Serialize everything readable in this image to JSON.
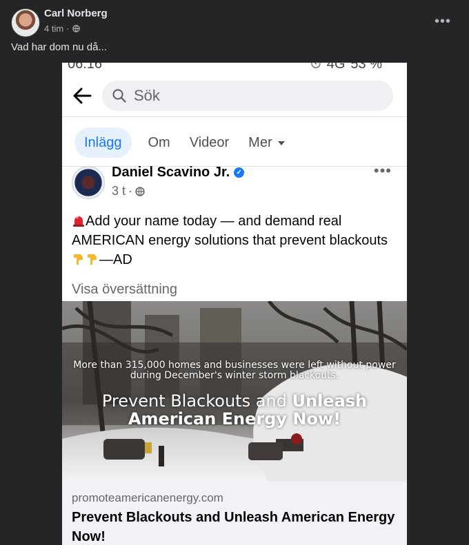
{
  "post": {
    "author": "Carl Norberg",
    "time": "4 tim",
    "separator": "·",
    "text": "Vad har dom nu då..."
  },
  "screenshot": {
    "status_bar": {
      "time": "06:16",
      "network": "4G",
      "battery": "53 %"
    },
    "search": {
      "placeholder": "Sök"
    },
    "tabs": [
      {
        "label": "Inlägg",
        "active": true
      },
      {
        "label": "Om",
        "active": false
      },
      {
        "label": "Videor",
        "active": false
      },
      {
        "label": "Mer",
        "active": false
      }
    ],
    "page_post": {
      "page_name": "Daniel Scavino Jr.",
      "time": "3 t",
      "separator": "·",
      "text_part1": "Add your name today — and demand real AMERICAN energy solutions that prevent blackouts",
      "text_part2": "—AD",
      "translate_link": "Visa översättning"
    },
    "ad": {
      "subtitle": "More than 315,000 homes and businesses were left without power during December's winter storm blackouts.",
      "headline_part1": "Prevent Blackouts and ",
      "headline_part2": "Unleash American Energy Now!",
      "domain": "promoteamericanenergy.com",
      "title": "Prevent Blackouts and Unleash American Energy Now!"
    }
  },
  "colors": {
    "facebook_dark_bg": "#242526",
    "facebook_blue": "#1877f2",
    "active_tab_bg": "#e7f0fd",
    "link_preview_bg": "#f0f2f5"
  },
  "icons": [
    "globe-icon",
    "more-options-icon",
    "back-arrow-icon",
    "search-icon",
    "caret-down-icon",
    "verified-badge-icon",
    "siren-emoji-icon",
    "point-down-emoji-icon"
  ]
}
